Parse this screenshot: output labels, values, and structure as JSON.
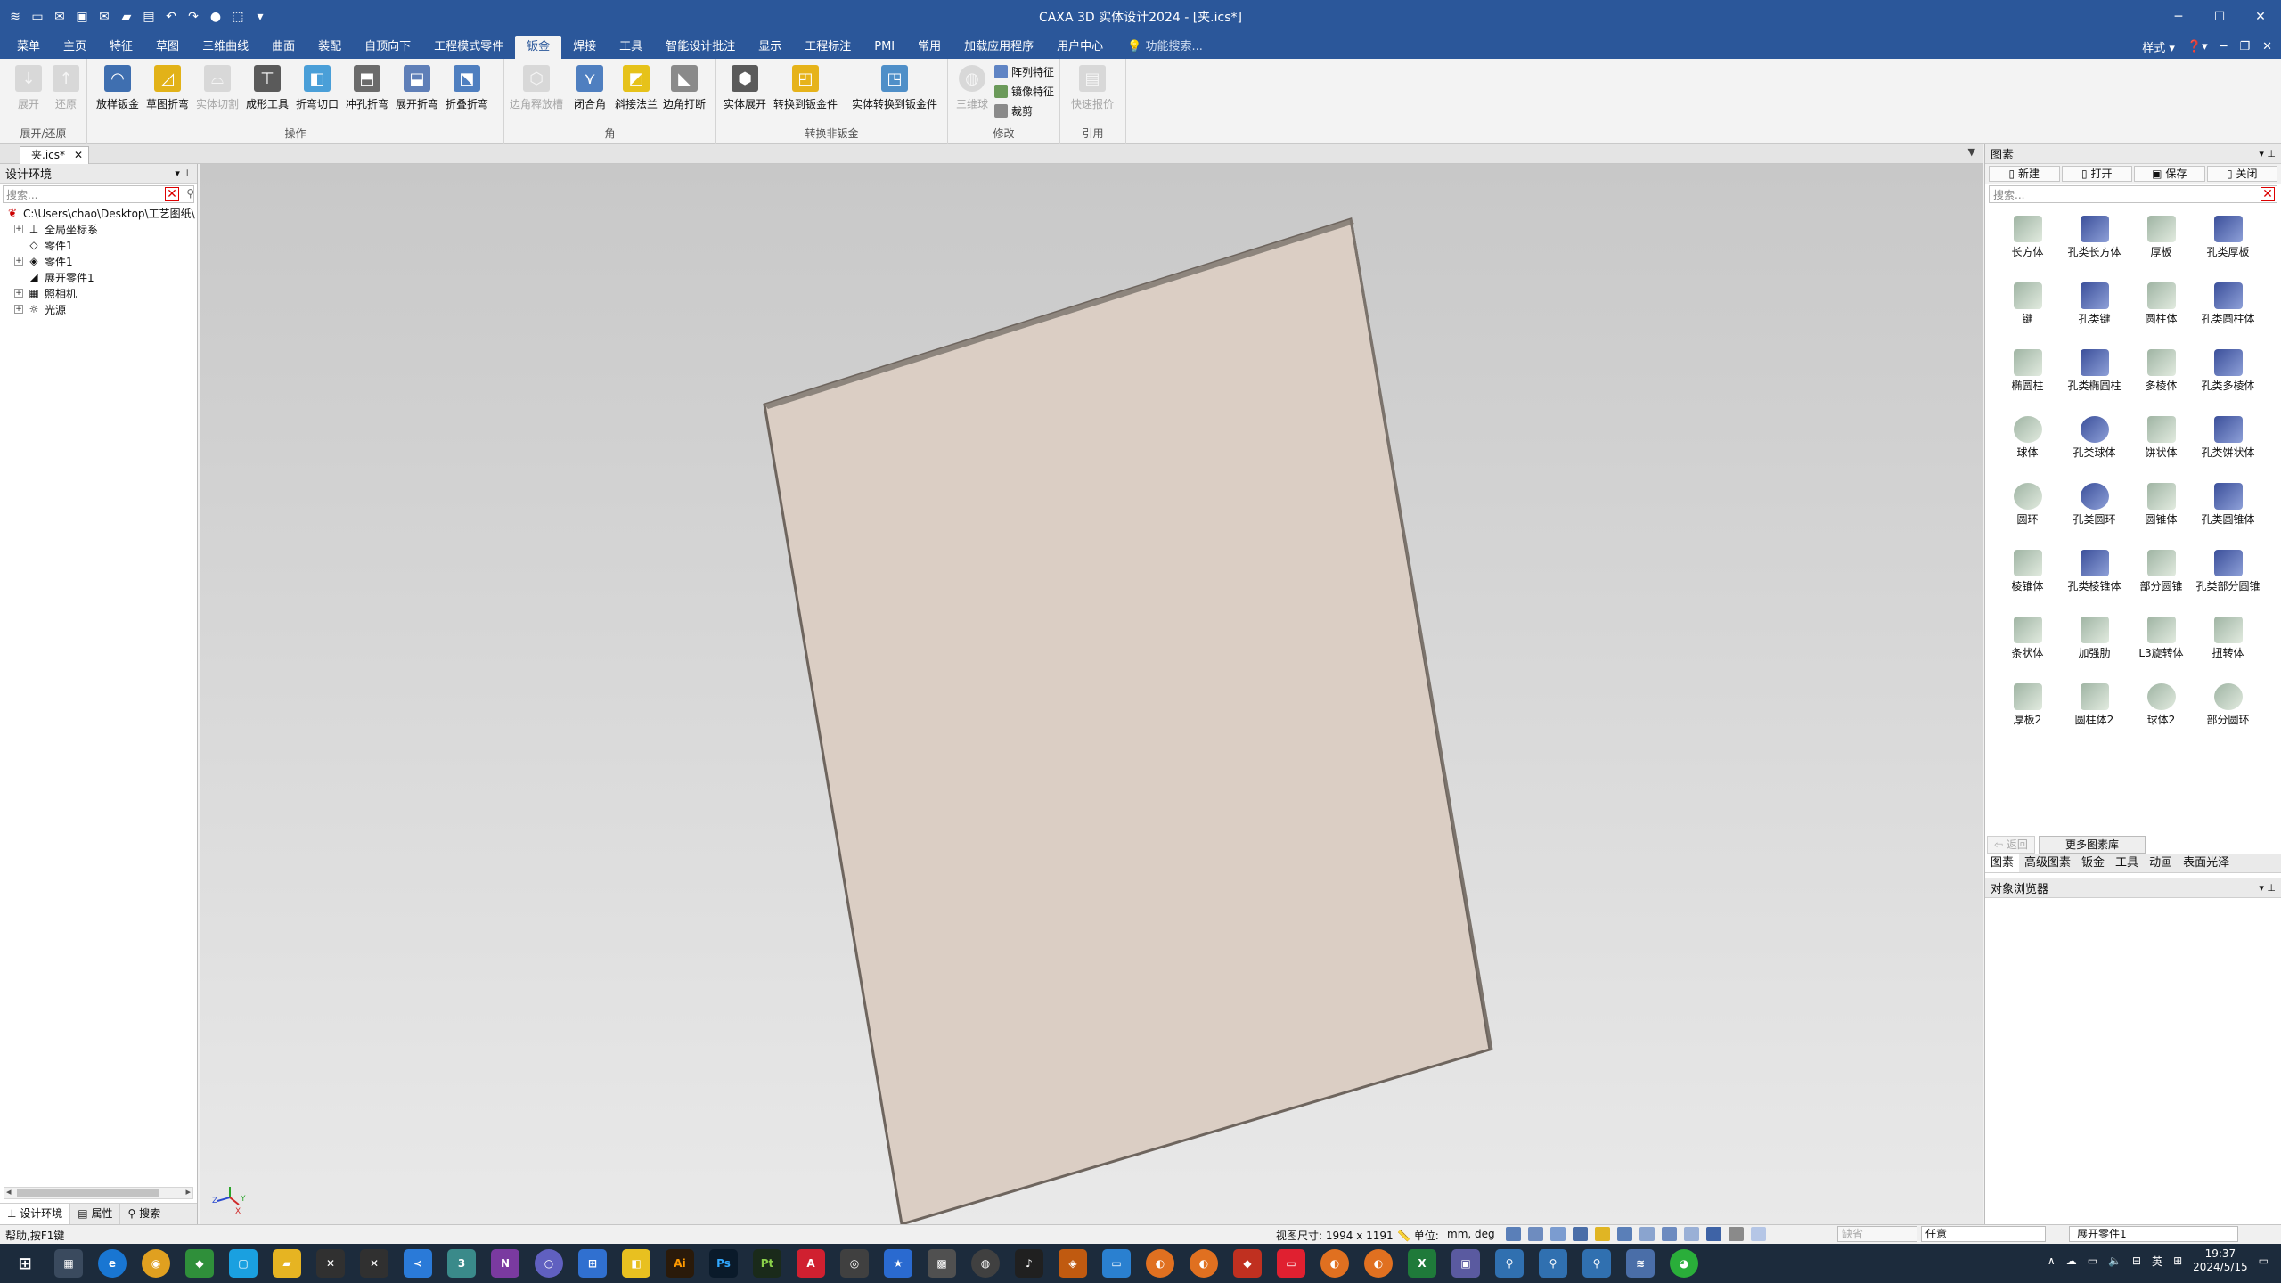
{
  "window": {
    "title": "CAXA 3D 实体设计2024 - [夹.ics*]"
  },
  "menu": {
    "tabs": [
      "菜单",
      "主页",
      "特征",
      "草图",
      "三维曲线",
      "曲面",
      "装配",
      "自顶向下",
      "工程模式零件",
      "钣金",
      "焊接",
      "工具",
      "智能设计批注",
      "显示",
      "工程标注",
      "PMI",
      "常用",
      "加载应用程序",
      "用户中心"
    ],
    "active_tab": "钣金",
    "search_placeholder": "功能搜索...",
    "style_label": "样式"
  },
  "ribbon": {
    "groups": {
      "unfold": {
        "label": "展开/还原",
        "buttons": [
          "展开",
          "还原"
        ]
      },
      "ops": {
        "label": "操作",
        "buttons": [
          "放样钣金",
          "草图折弯",
          "实体切割",
          "成形工具",
          "折弯切口",
          "冲孔折弯",
          "展开折弯",
          "折叠折弯"
        ]
      },
      "corner": {
        "label": "角",
        "buttons": [
          "边角释放槽",
          "闭合角",
          "斜接法兰",
          "边角打断"
        ]
      },
      "convert": {
        "label": "转换非钣金",
        "buttons": [
          "实体展开",
          "转换到钣金件",
          "实体转换到钣金件"
        ]
      },
      "modify": {
        "label": "修改",
        "buttons": [
          "三维球"
        ],
        "small": [
          "阵列特征",
          "镜像特征",
          "裁剪"
        ]
      },
      "ref": {
        "label": "引用",
        "buttons": [
          "快速报价"
        ]
      }
    }
  },
  "doc_tab": {
    "label": "夹.ics*"
  },
  "left_panel": {
    "title": "设计环境",
    "search_placeholder": "搜索...",
    "tree": {
      "root": "C:\\Users\\chao\\Desktop\\工艺图纸\\",
      "children": [
        "全局坐标系",
        "零件1",
        "零件1",
        "展开零件1",
        "照相机",
        "光源"
      ]
    },
    "bottom_tabs": [
      "设计环境",
      "属性",
      "搜索"
    ]
  },
  "right_panel": {
    "title": "图素",
    "toolbar": [
      "新建",
      "打开",
      "保存",
      "关闭"
    ],
    "search_placeholder": "搜索...",
    "items": [
      "长方体",
      "孔类长方体",
      "厚板",
      "孔类厚板",
      "键",
      "孔类键",
      "圆柱体",
      "孔类圆柱体",
      "椭圆柱",
      "孔类椭圆柱",
      "多棱体",
      "孔类多棱体",
      "球体",
      "孔类球体",
      "饼状体",
      "孔类饼状体",
      "圆环",
      "孔类圆环",
      "圆锥体",
      "孔类圆锥体",
      "棱锥体",
      "孔类棱锥体",
      "部分圆锥",
      "孔类部分圆锥",
      "条状体",
      "加强肋",
      "L3旋转体",
      "扭转体",
      "厚板2",
      "圆柱体2",
      "球体2",
      "部分圆环"
    ],
    "back_label": "返回",
    "more_label": "更多图素库",
    "categories": [
      "图素",
      "高级图素",
      "钣金",
      "工具",
      "动画",
      "表面光泽"
    ],
    "object_browser": "对象浏览器"
  },
  "status": {
    "help": "帮助,按F1键",
    "view_size": "视图尺寸: 1994 x 1191",
    "unit_label": "单位:",
    "unit_value": "mm, deg",
    "field1": "缺省",
    "field2": "任意",
    "field3": "展开零件1"
  },
  "taskbar": {
    "time": "19:37",
    "date": "2024/5/15",
    "lang": "英"
  },
  "axis_labels": {
    "z": "Z",
    "y": "Y",
    "x": "X"
  }
}
